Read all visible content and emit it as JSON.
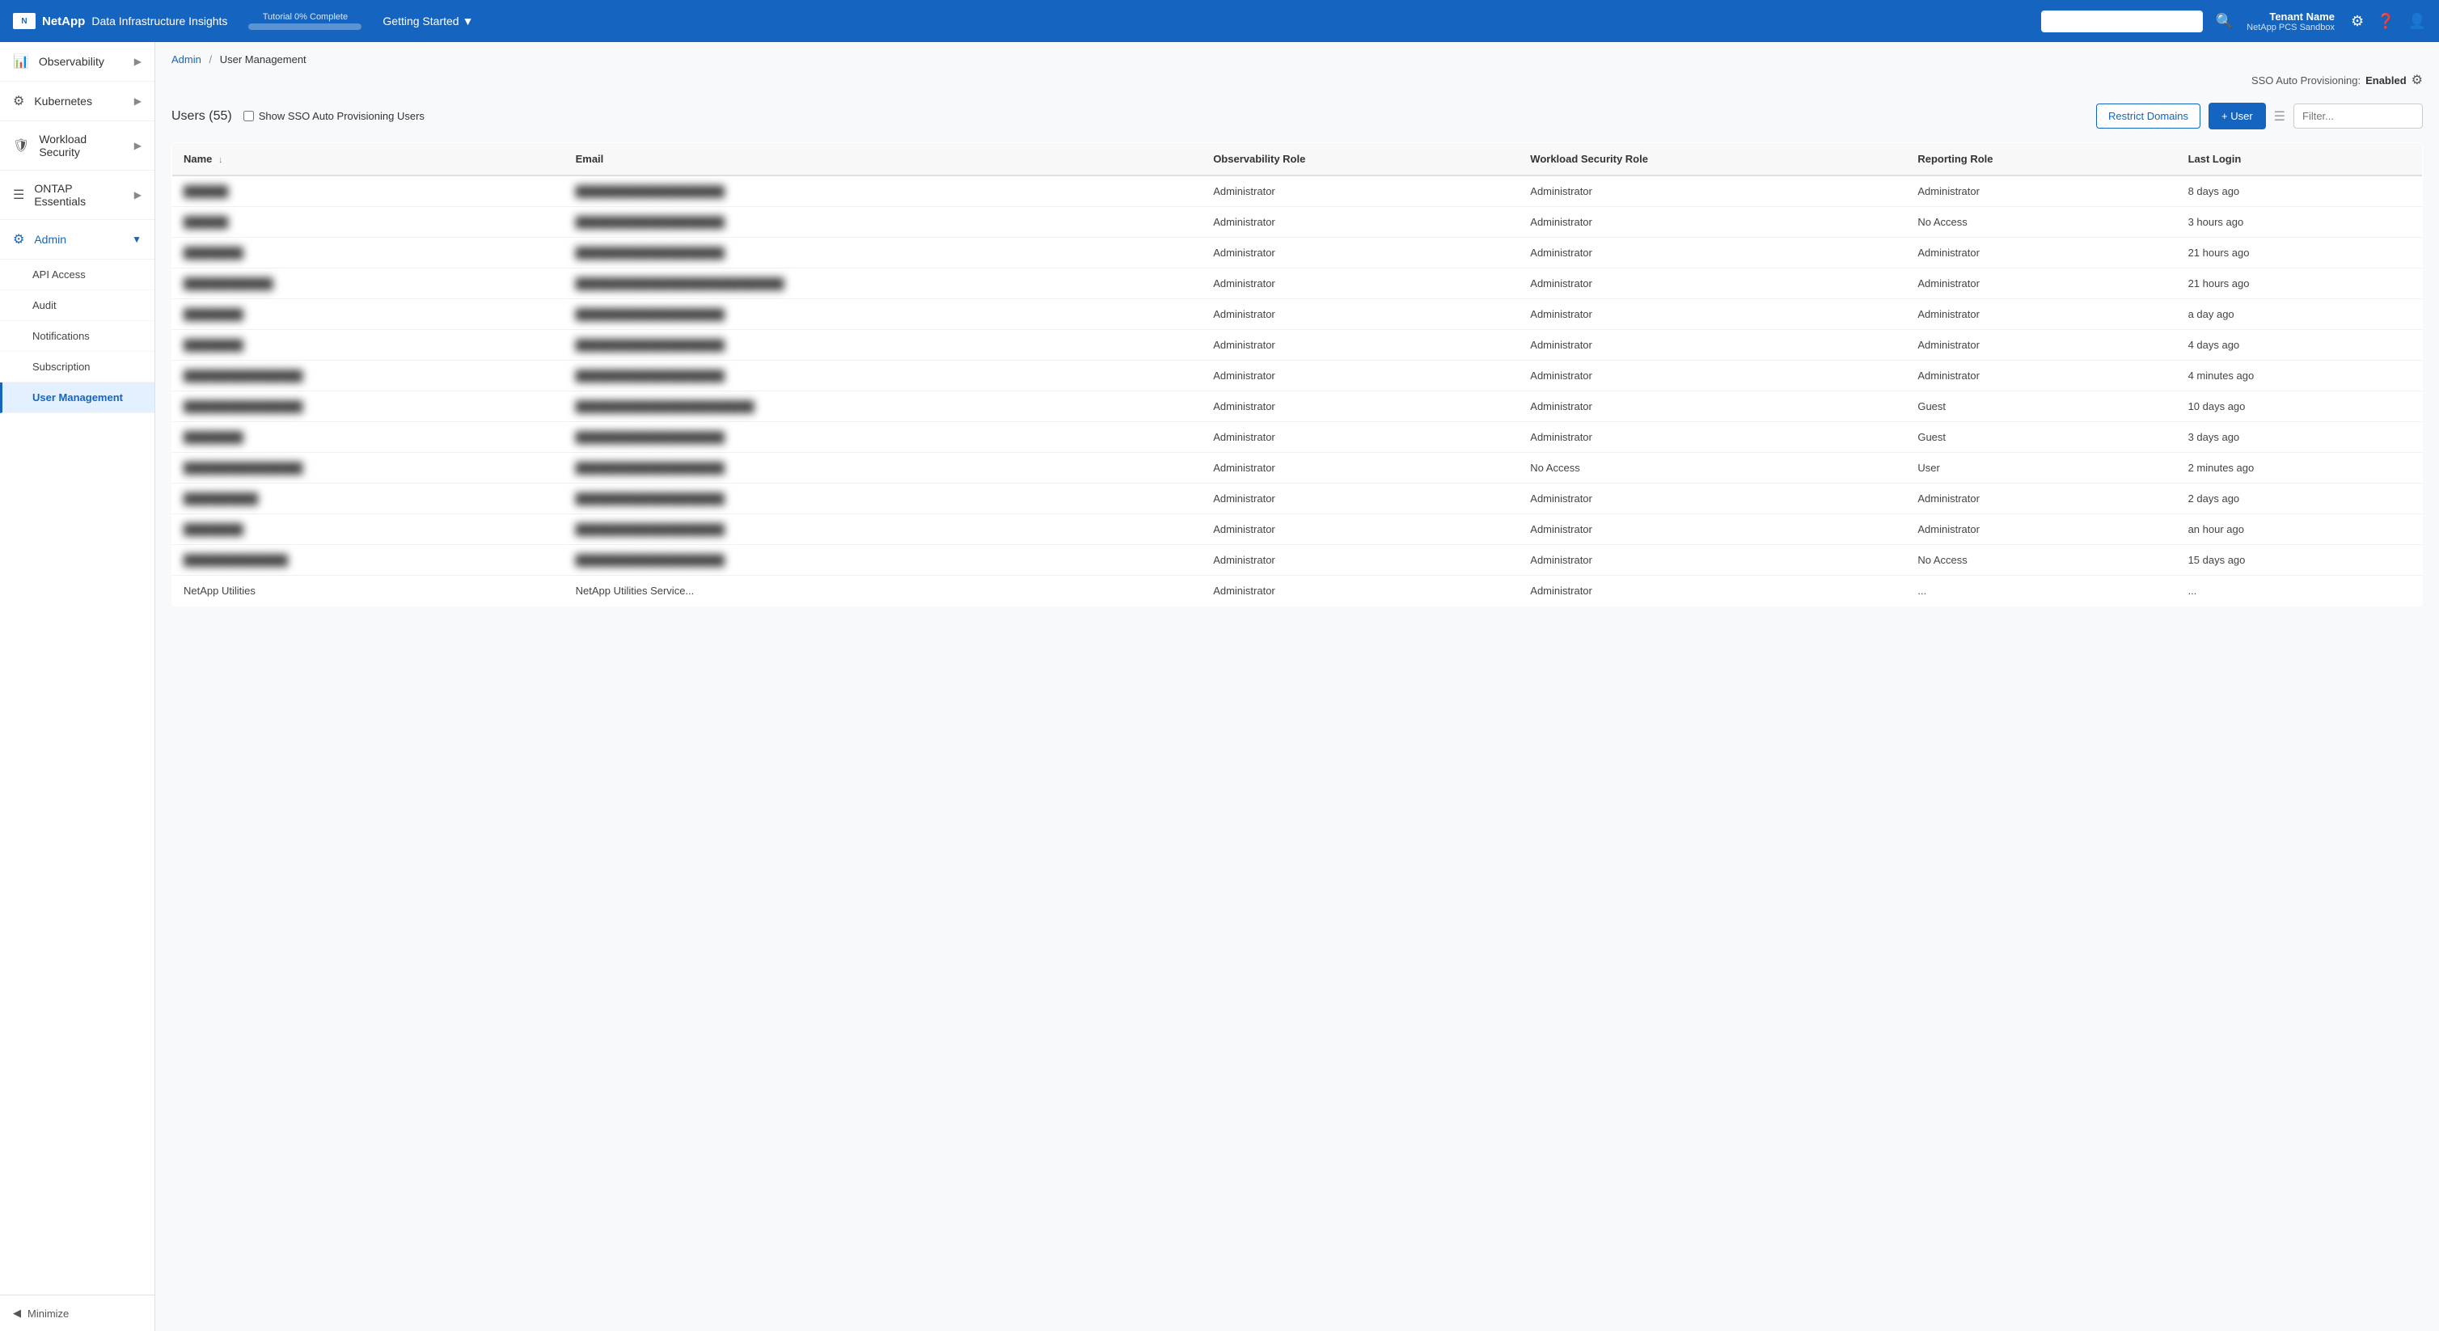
{
  "header": {
    "brand_name": "NetApp",
    "product_name": "Data Infrastructure Insights",
    "tutorial_label": "Tutorial 0% Complete",
    "tutorial_percent": 0,
    "getting_started": "Getting Started",
    "tenant_name": "Tenant Name",
    "tenant_sub": "NetApp PCS Sandbox",
    "search_placeholder": ""
  },
  "sidebar": {
    "items": [
      {
        "id": "observability",
        "label": "Observability",
        "icon": "📊",
        "has_children": true
      },
      {
        "id": "kubernetes",
        "label": "Kubernetes",
        "icon": "⚙",
        "has_children": true
      },
      {
        "id": "workload-security",
        "label": "Workload Security",
        "icon": "🛡",
        "has_children": true
      },
      {
        "id": "ontap-essentials",
        "label": "ONTAP Essentials",
        "icon": "☰",
        "has_children": true
      },
      {
        "id": "admin",
        "label": "Admin",
        "icon": "⚙",
        "has_children": true,
        "expanded": true
      }
    ],
    "admin_sub_items": [
      {
        "id": "api-access",
        "label": "API Access",
        "active": false
      },
      {
        "id": "audit",
        "label": "Audit",
        "active": false
      },
      {
        "id": "notifications",
        "label": "Notifications",
        "active": false
      },
      {
        "id": "subscription",
        "label": "Subscription",
        "active": false
      },
      {
        "id": "user-management",
        "label": "User Management",
        "active": true
      }
    ],
    "minimize_label": "Minimize"
  },
  "breadcrumb": {
    "parent": "Admin",
    "current": "User Management"
  },
  "sso_bar": {
    "label": "SSO Auto Provisioning:",
    "status": "Enabled",
    "settings_icon": "⚙"
  },
  "table_header": {
    "users_label": "Users",
    "users_count": "55",
    "show_sso_label": "Show SSO Auto Provisioning Users",
    "restrict_domains_label": "Restrict Domains",
    "add_user_label": "+ User",
    "filter_placeholder": "Filter..."
  },
  "columns": [
    {
      "key": "name",
      "label": "Name",
      "sortable": true
    },
    {
      "key": "email",
      "label": "Email",
      "sortable": false
    },
    {
      "key": "observability_role",
      "label": "Observability Role",
      "sortable": false
    },
    {
      "key": "workload_security_role",
      "label": "Workload Security Role",
      "sortable": false
    },
    {
      "key": "reporting_role",
      "label": "Reporting Role",
      "sortable": false
    },
    {
      "key": "last_login",
      "label": "Last Login",
      "sortable": false
    }
  ],
  "rows": [
    {
      "name": "██████",
      "email": "████████████████████",
      "observability_role": "Administrator",
      "workload_security_role": "Administrator",
      "reporting_role": "Administrator",
      "last_login": "8 days ago",
      "blurred": true
    },
    {
      "name": "██████",
      "email": "████████████████████",
      "observability_role": "Administrator",
      "workload_security_role": "Administrator",
      "reporting_role": "No Access",
      "last_login": "3 hours ago",
      "blurred": true
    },
    {
      "name": "████████",
      "email": "████████████████████",
      "observability_role": "Administrator",
      "workload_security_role": "Administrator",
      "reporting_role": "Administrator",
      "last_login": "21 hours ago",
      "blurred": true
    },
    {
      "name": "████████████",
      "email": "████████████████████████████",
      "observability_role": "Administrator",
      "workload_security_role": "Administrator",
      "reporting_role": "Administrator",
      "last_login": "21 hours ago",
      "blurred": true
    },
    {
      "name": "████████",
      "email": "████████████████████",
      "observability_role": "Administrator",
      "workload_security_role": "Administrator",
      "reporting_role": "Administrator",
      "last_login": "a day ago",
      "blurred": true
    },
    {
      "name": "████████",
      "email": "████████████████████",
      "observability_role": "Administrator",
      "workload_security_role": "Administrator",
      "reporting_role": "Administrator",
      "last_login": "4 days ago",
      "blurred": true
    },
    {
      "name": "████████████████",
      "email": "████████████████████",
      "observability_role": "Administrator",
      "workload_security_role": "Administrator",
      "reporting_role": "Administrator",
      "last_login": "4 minutes ago",
      "blurred": true
    },
    {
      "name": "████████████████",
      "email": "████████████████████████",
      "observability_role": "Administrator",
      "workload_security_role": "Administrator",
      "reporting_role": "Guest",
      "last_login": "10 days ago",
      "blurred": true
    },
    {
      "name": "████████",
      "email": "████████████████████",
      "observability_role": "Administrator",
      "workload_security_role": "Administrator",
      "reporting_role": "Guest",
      "last_login": "3 days ago",
      "blurred": true
    },
    {
      "name": "████████████████",
      "email": "████████████████████",
      "observability_role": "Administrator",
      "workload_security_role": "No Access",
      "reporting_role": "User",
      "last_login": "2 minutes ago",
      "blurred": true
    },
    {
      "name": "██████████",
      "email": "████████████████████",
      "observability_role": "Administrator",
      "workload_security_role": "Administrator",
      "reporting_role": "Administrator",
      "last_login": "2 days ago",
      "blurred": true
    },
    {
      "name": "████████",
      "email": "████████████████████",
      "observability_role": "Administrator",
      "workload_security_role": "Administrator",
      "reporting_role": "Administrator",
      "last_login": "an hour ago",
      "blurred": true
    },
    {
      "name": "██████████████",
      "email": "████████████████████",
      "observability_role": "Administrator",
      "workload_security_role": "Administrator",
      "reporting_role": "No Access",
      "last_login": "15 days ago",
      "blurred": true
    },
    {
      "name": "NetApp Utilities",
      "email": "NetApp Utilities Service...",
      "observability_role": "Administrator",
      "workload_security_role": "Administrator",
      "reporting_role": "...",
      "last_login": "...",
      "blurred": false,
      "partial": true
    }
  ]
}
